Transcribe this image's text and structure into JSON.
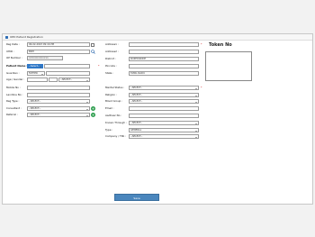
{
  "window": {
    "title": "OPD Patient Registration"
  },
  "left": {
    "reg_date_label": "Reg Date :",
    "reg_date_value": "06-02-2023 09:16 PM",
    "uhid_label": "UHID :",
    "uhid_value": "BNH",
    "op_number_label": "OP Number :",
    "op_number_value": "OP00000000296",
    "patient_name_label": "Patient Name :",
    "patient_name_title": "--Select--",
    "guardian_label": "Guardian :",
    "guardian_value": "FATHER",
    "age_gender_label": "Age / Gender :",
    "age_gender_select": "--SELECT--",
    "mobile_label": "Mobile No :",
    "landline_label": "Landline No :",
    "reg_type_label": "Reg Type :",
    "reg_type_value": "--SELECT--",
    "consultant_label": "Consultant :",
    "consultant_value": "--SELECT--",
    "referral_label": "Referral :",
    "referral_value": "--SELECT--"
  },
  "middle": {
    "address1_label": "Address1 :",
    "address2_label": "Address2 :",
    "district_label": "District :",
    "district_value": "KOZHIKKODE",
    "pincode_label": "Pincode :",
    "state_label": "State :",
    "state_value": "TAMIL NADU",
    "marital_label": "Marital Status :",
    "marital_value": "--SELECT--",
    "religion_label": "Religion :",
    "religion_value": "--SELECT--",
    "blood_label": "Blood Group :",
    "blood_value": "--SELECT--",
    "email_label": "Email :",
    "aadhaar_label": "Aadhaar No :",
    "known_label": "Known Through :",
    "known_value": "--SELECT--",
    "type_label": "Type :",
    "type_value": "GENERAL",
    "company_label": "Company / TPA :",
    "company_value": "--SELECT--"
  },
  "token": {
    "title": "Token No"
  },
  "save_label": "Save"
}
